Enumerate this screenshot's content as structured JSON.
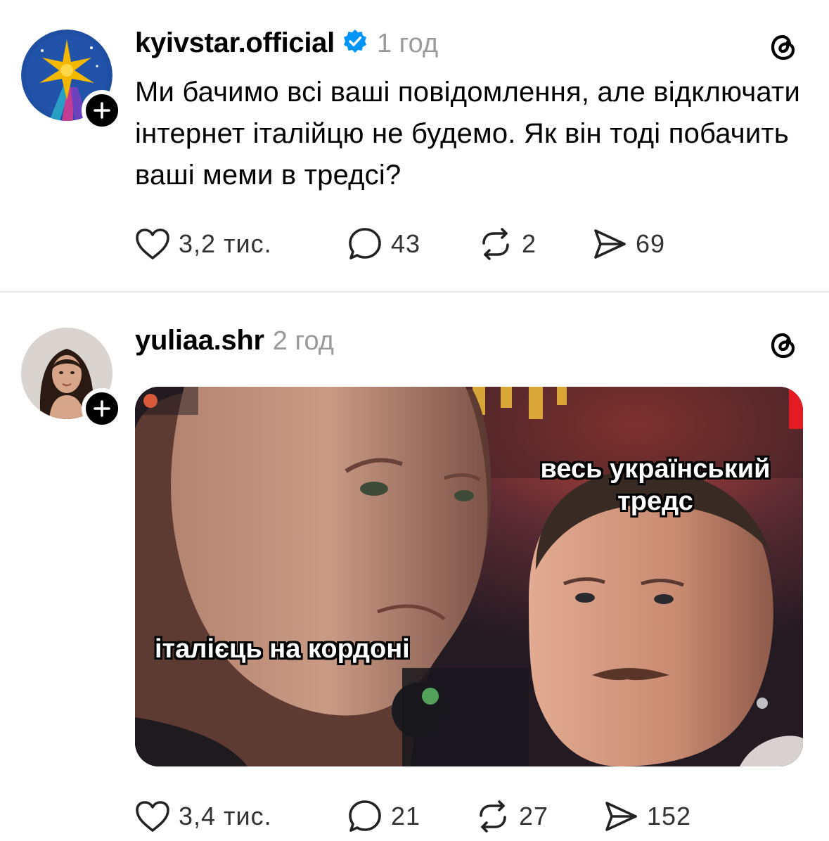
{
  "posts": [
    {
      "username": "kyivstar.official",
      "verified": true,
      "time": "1 год",
      "text": "Ми бачимо всі ваші повідомлення, але відключати інтернет італійцю не будемо. Як він тоді побачить ваші меми в тредсі?",
      "likes": "3,2 тис.",
      "replies": "43",
      "reposts": "2",
      "shares": "69"
    },
    {
      "username": "yuliaa.shr",
      "verified": false,
      "time": "2 год",
      "media": {
        "caption_right_line1": "весь український",
        "caption_right_line2": "тредс",
        "caption_left": "італієць на кордоні"
      },
      "likes": "3,4 тис.",
      "replies": "21",
      "reposts": "27",
      "shares": "152"
    }
  ],
  "colors": {
    "verified": "#0095f6",
    "muted": "#9a9a9a",
    "kyivstar_bg": "#1e4fa3",
    "kyivstar_star": "#f4b800"
  },
  "icons": [
    "plus-icon",
    "verified-icon",
    "threads-icon",
    "heart-icon",
    "reply-icon",
    "repost-icon",
    "share-icon"
  ]
}
